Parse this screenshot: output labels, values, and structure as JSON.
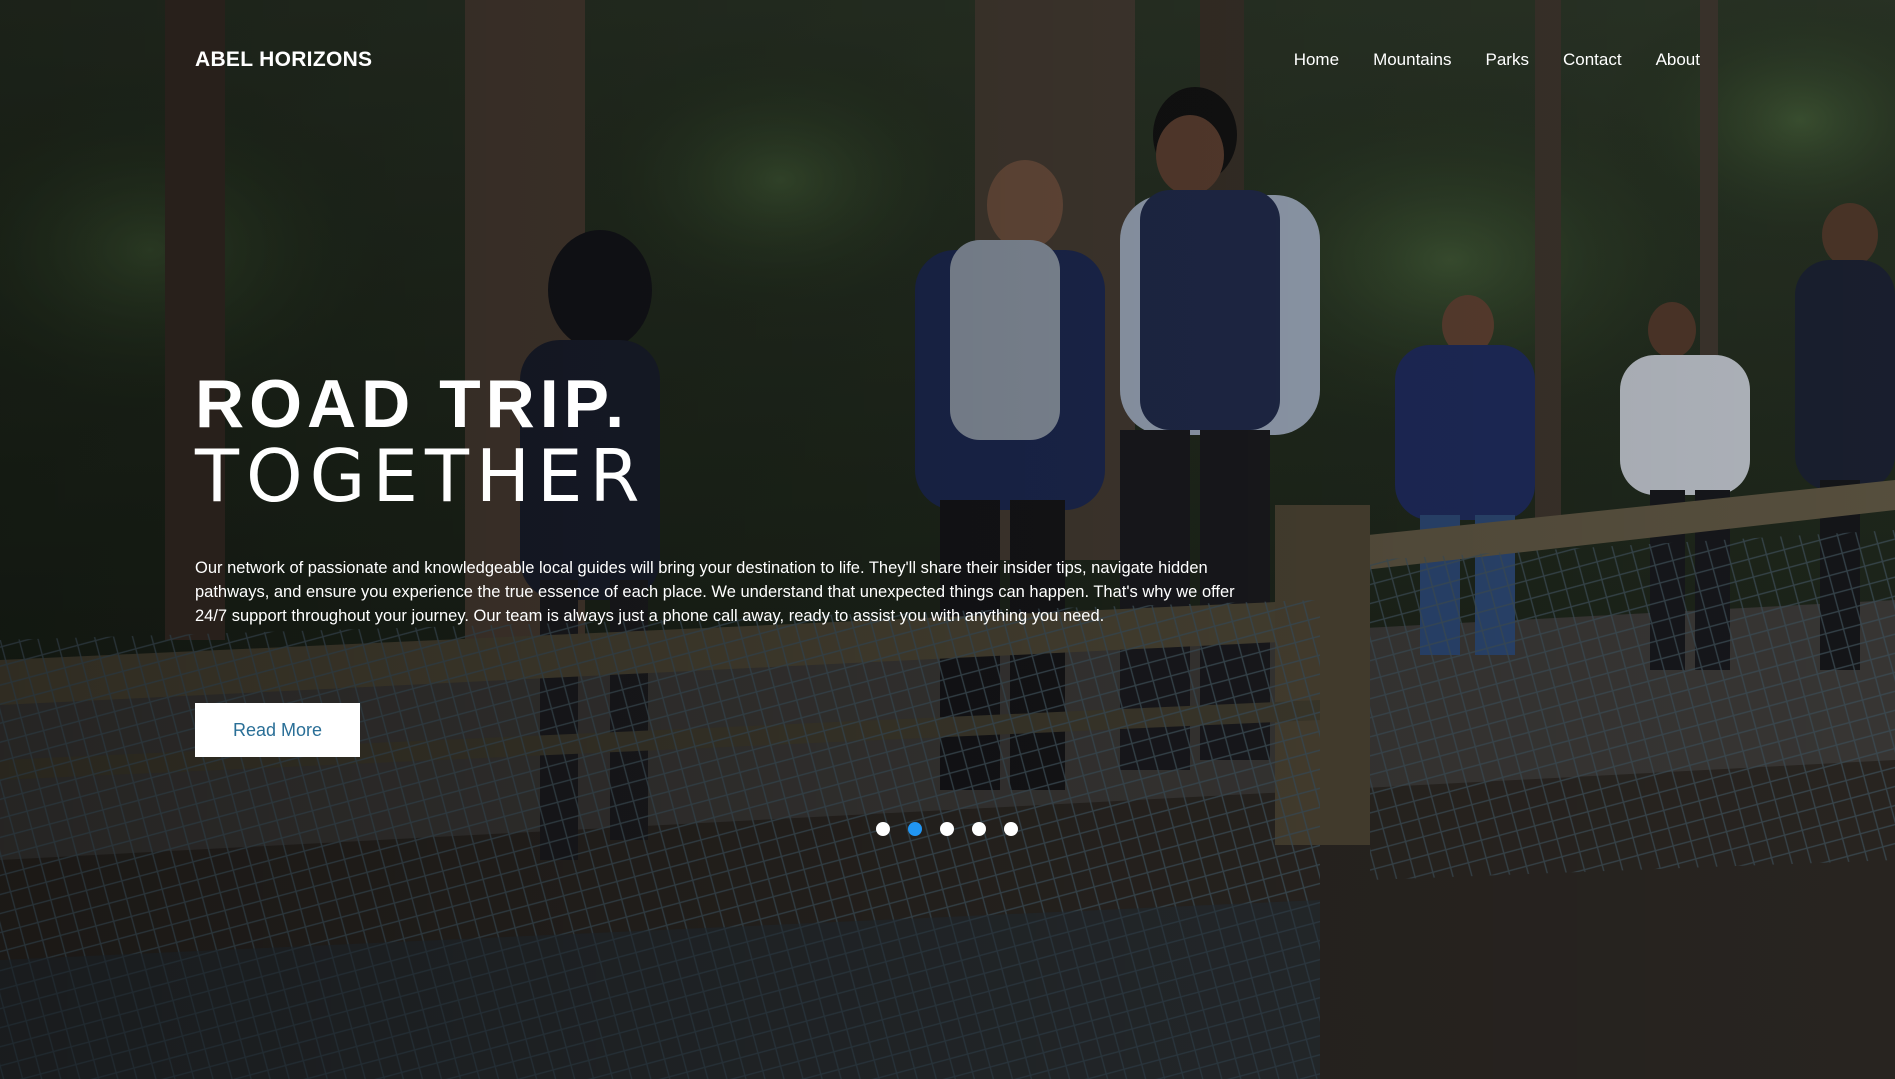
{
  "brand": {
    "name": "ABEL HORIZONS"
  },
  "nav": {
    "items": [
      {
        "label": "Home"
      },
      {
        "label": "Mountains"
      },
      {
        "label": "Parks"
      },
      {
        "label": "Contact"
      },
      {
        "label": "About"
      }
    ]
  },
  "hero": {
    "title_line1": "ROAD TRIP.",
    "title_line2": "TOGETHER",
    "description": "Our network of passionate and knowledgeable local guides will bring your destination to life. They'll share their insider tips, navigate hidden pathways, and ensure you experience the true essence of each place. We understand that unexpected things can happen. That's why we offer 24/7 support throughout your journey. Our team is always just a phone call away, ready to assist you with anything you need.",
    "button_label": "Read More"
  },
  "slider": {
    "count": 5,
    "active_index": 1,
    "accent_color": "#2196f3"
  },
  "colors": {
    "button_text": "#2a6f97",
    "button_bg": "#ffffff"
  }
}
